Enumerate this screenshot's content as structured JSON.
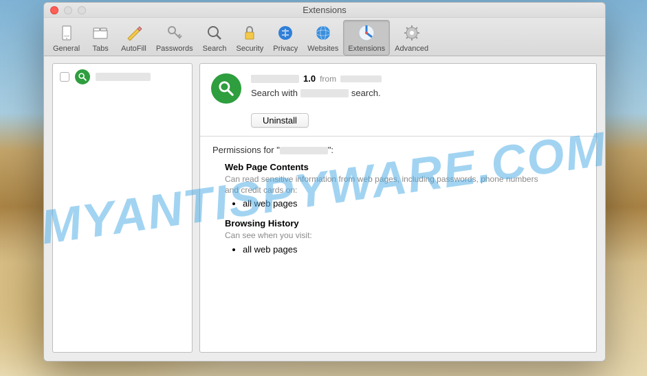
{
  "window": {
    "title": "Extensions"
  },
  "toolbar": {
    "items": [
      {
        "label": "General"
      },
      {
        "label": "Tabs"
      },
      {
        "label": "AutoFill"
      },
      {
        "label": "Passwords"
      },
      {
        "label": "Search"
      },
      {
        "label": "Security"
      },
      {
        "label": "Privacy"
      },
      {
        "label": "Websites"
      },
      {
        "label": "Extensions"
      },
      {
        "label": "Advanced"
      }
    ]
  },
  "sidebar": {
    "items": [
      {
        "name_redacted": true
      }
    ]
  },
  "detail": {
    "version": "1.0",
    "from_label": "from",
    "desc_prefix": "Search with",
    "desc_suffix": "search.",
    "uninstall": "Uninstall"
  },
  "permissions": {
    "heading_prefix": "Permissions for \"",
    "heading_suffix": "\":",
    "sections": [
      {
        "title": "Web Page Contents",
        "desc": "Can read sensitive information from web pages, including passwords, phone numbers and credit cards on:",
        "items": [
          "all web pages"
        ]
      },
      {
        "title": "Browsing History",
        "desc": "Can see when you visit:",
        "items": [
          "all web pages"
        ]
      }
    ]
  },
  "watermark": "MYANTISPYWARE.COM"
}
